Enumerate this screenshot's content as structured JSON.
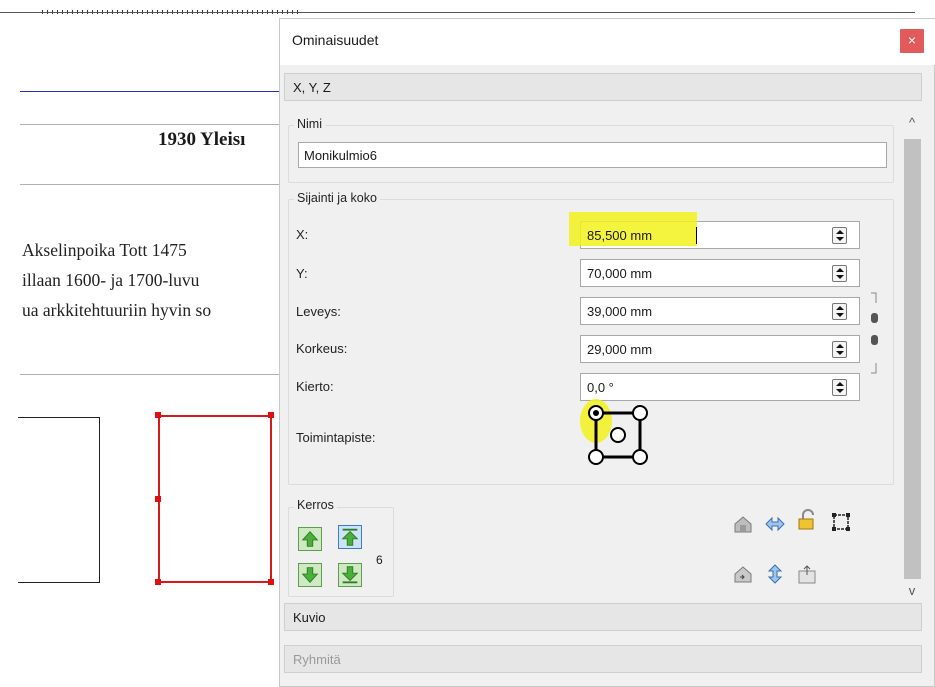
{
  "document": {
    "heading": "1930 Yleisı",
    "lines": [
      "Akselinpoika Tott 1475",
      "illaan 1600- ja 1700-luvu",
      "ua arkkitehtuuriin hyvin so"
    ]
  },
  "panel": {
    "title": "Ominaisuudet",
    "close_glyph": "×",
    "sections": {
      "xyz": "X, Y, Z",
      "kuvio": "Kuvio",
      "ryhmita": "Ryhmitä"
    },
    "name_group": {
      "label": "Nimi",
      "value": "Monikulmio6"
    },
    "geometry_group": {
      "label": "Sijainti ja koko",
      "rows": [
        {
          "label": "X:",
          "value": "85,500 mm"
        },
        {
          "label": "Y:",
          "value": "70,000 mm"
        },
        {
          "label": "Leveys:",
          "value": "39,000 mm"
        },
        {
          "label": "Korkeus:",
          "value": "29,000 mm"
        },
        {
          "label": "Kierto:",
          "value": "0,0 °"
        }
      ],
      "pivot_label": "Toimintapiste:"
    },
    "layer_group": {
      "label": "Kerros",
      "count": "6"
    },
    "colors": {
      "highlight": "#f2f21c",
      "close_button": "#e35a5a",
      "selection_red": "#d61a1a"
    }
  }
}
